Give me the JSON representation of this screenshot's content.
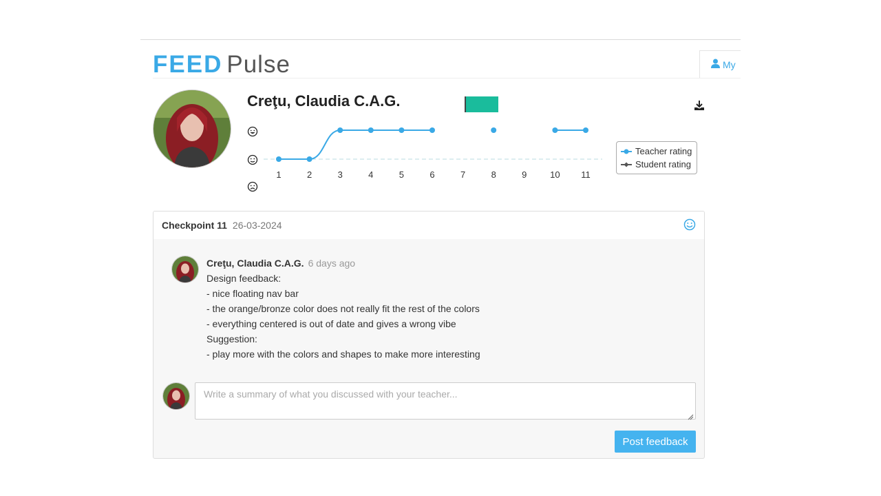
{
  "brand": {
    "logo_part1": "FEED",
    "logo_part2": "Pulse"
  },
  "nav": {
    "my_tab_label": "My"
  },
  "student": {
    "name": "Creţu, Claudia C.A.G."
  },
  "chart_data": {
    "type": "line",
    "x": [
      1,
      2,
      3,
      4,
      5,
      6,
      7,
      8,
      9,
      10,
      11
    ],
    "y_levels": [
      "sad",
      "neutral",
      "happy"
    ],
    "series": [
      {
        "name": "Teacher rating",
        "color": "#3aa9e6",
        "values": [
          "neutral",
          "neutral",
          "happy",
          "happy",
          "happy",
          "happy",
          null,
          "happy",
          null,
          "happy",
          "happy"
        ]
      },
      {
        "name": "Student rating",
        "color": "#555555",
        "values": []
      }
    ],
    "legend_position": "right"
  },
  "checkpoint": {
    "title": "Checkpoint 11",
    "date": "26-03-2024",
    "rating_icon": "smile-icon"
  },
  "comment": {
    "author": "Creţu, Claudia C.A.G.",
    "time": "6 days ago",
    "lines": [
      "Design feedback:",
      "- nice floating nav bar",
      "- the orange/bronze color does not really fit the rest of the colors",
      "- everything centered is out of date and gives a wrong vibe",
      "Suggestion:",
      "- play more with the colors and shapes to make more interesting"
    ]
  },
  "reply": {
    "placeholder": "Write a summary of what you discussed with your teacher...",
    "button_label": "Post feedback"
  },
  "colors": {
    "accent": "#3aa9e6",
    "button": "#45b3ef",
    "flag": "#1abc9c"
  }
}
